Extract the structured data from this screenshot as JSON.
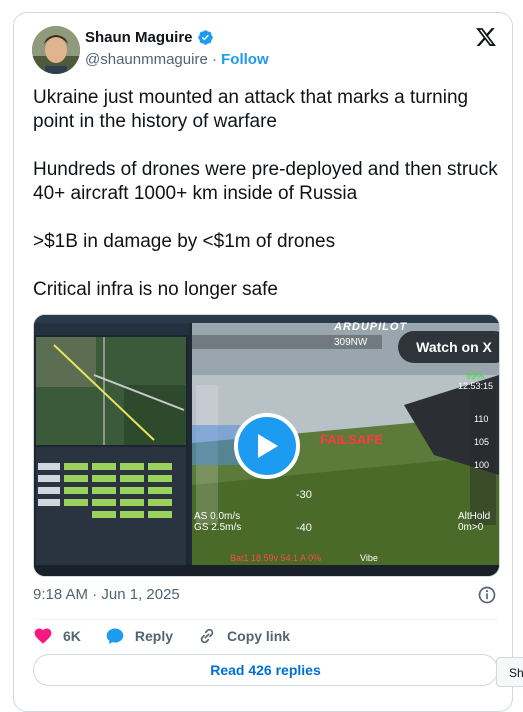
{
  "author": {
    "name": "Shaun Maguire",
    "handle": "@shaunmmaguire",
    "separator": "·",
    "follow_label": "Follow"
  },
  "tweet": {
    "paragraphs": [
      "Ukraine just mounted an attack that marks a turning point in the history of warfare",
      "Hundreds of drones were pre-deployed and then struck 40+ aircraft 1000+ km inside of Russia",
      ">$1B in damage by <$1m of drones",
      "Critical infra is no longer safe"
    ]
  },
  "media": {
    "watch_label": "Watch on X",
    "overlay": {
      "brand": "ARDUPILOT",
      "failsafe": "FAILSAFE",
      "as": "AS 0.0m/s",
      "gs": "GS 2.5m/s",
      "alt_hold": "AltHold",
      "alt_val": "0m>0",
      "batt": "Bat1 18.59v 54.1 A 0%",
      "vibe": "Vibe",
      "heading": "309NW",
      "time": "12:53:15",
      "pct": "99%",
      "ticks": [
        "-30",
        "-40",
        "110",
        "105",
        "100"
      ]
    }
  },
  "meta": {
    "timestamp": "9:18 AM · Jun 1, 2025"
  },
  "actions": {
    "like_count": "6K",
    "reply_label": "Reply",
    "copy_label": "Copy link"
  },
  "replies_button": "Read 426 replies",
  "side_chip": "Sh",
  "colors": {
    "brand_blue": "#1d9bf0",
    "like_pink": "#f91880",
    "link_blue": "#006fd6",
    "secondary_text": "#536471"
  }
}
